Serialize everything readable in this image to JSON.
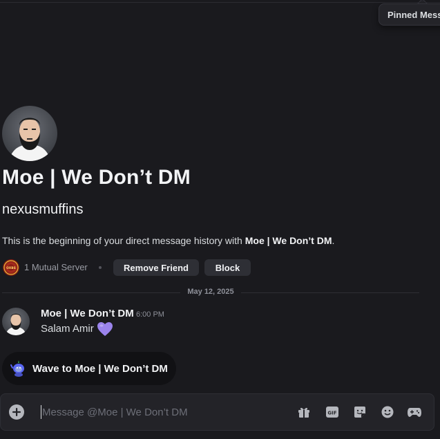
{
  "tooltip": {
    "label": "Pinned Messages"
  },
  "profile": {
    "display_name": "Moe | We Don’t DM",
    "username": "nexusmuffins",
    "intro_prefix": "This is the beginning of your direct message history with ",
    "intro_name": "Moe | We Don’t DM",
    "intro_suffix": "."
  },
  "mutual": {
    "label": "1 Mutual Server",
    "server_icon_text": "OXBS"
  },
  "actions": {
    "remove_friend": "Remove Friend",
    "block": "Block"
  },
  "divider": {
    "date": "May 12, 2025"
  },
  "message": {
    "author": "Moe | We Don’t DM",
    "time": "6:00 PM",
    "text": "Salam Amir",
    "emoji": "purple-heart-icon"
  },
  "wave": {
    "label": "Wave to Moe | We Don’t DM"
  },
  "composer": {
    "placeholder": "Message @Moe | We Don’t DM",
    "value": "",
    "gif_label": "GIF",
    "icons": [
      "plus-circle-icon",
      "gift-icon",
      "gif-icon",
      "sticker-icon",
      "emoji-icon",
      "gamepad-icon"
    ]
  },
  "colors": {
    "background": "#1a1a1e",
    "button": "#2e2f35",
    "composer": "#232328",
    "heart": "#9b84ec"
  }
}
